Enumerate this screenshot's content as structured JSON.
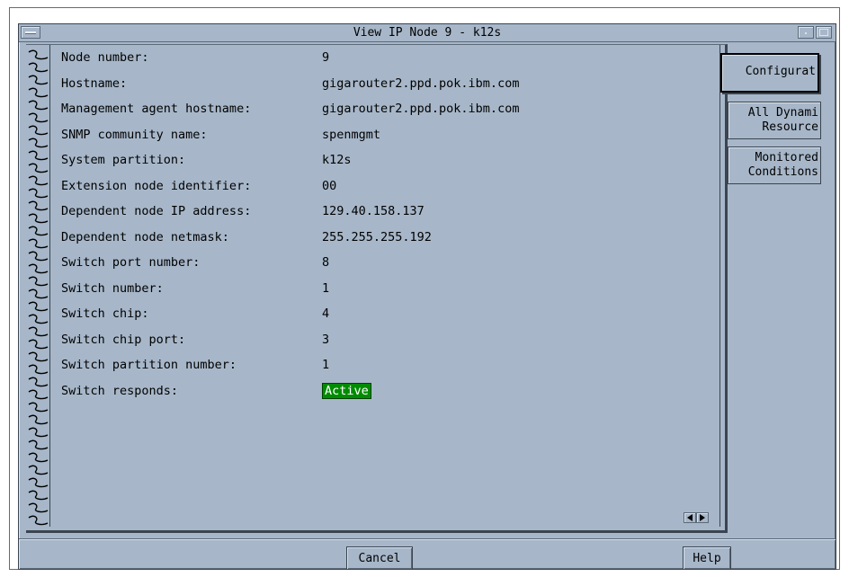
{
  "window": {
    "title": "View IP Node 9 - k12s"
  },
  "fields": [
    {
      "label": "Node number:",
      "value": "9"
    },
    {
      "label": "Hostname:",
      "value": "gigarouter2.ppd.pok.ibm.com"
    },
    {
      "label": "Management agent hostname:",
      "value": "gigarouter2.ppd.pok.ibm.com"
    },
    {
      "label": "SNMP community name:",
      "value": "spenmgmt"
    },
    {
      "label": "System partition:",
      "value": "k12s"
    },
    {
      "label": "Extension node identifier:",
      "value": "00"
    },
    {
      "label": "Dependent node IP address:",
      "value": "129.40.158.137"
    },
    {
      "label": "Dependent node netmask:",
      "value": "255.255.255.192"
    },
    {
      "label": "Switch port number:",
      "value": "8"
    },
    {
      "label": "Switch number:",
      "value": "1"
    },
    {
      "label": "Switch chip:",
      "value": "4"
    },
    {
      "label": "Switch chip port:",
      "value": "3"
    },
    {
      "label": "Switch partition number:",
      "value": "1"
    },
    {
      "label": "Switch responds:",
      "value": "Active"
    }
  ],
  "status_colors": {
    "active_bg": "#008c00",
    "active_fg": "#ffffff"
  },
  "tabs": [
    {
      "line1": "Configurat",
      "line2": ""
    },
    {
      "line1": "All Dynami",
      "line2": "Resource"
    },
    {
      "line1": "Monitored",
      "line2": "Conditions"
    }
  ],
  "buttons": {
    "cancel": "Cancel",
    "help": "Help"
  },
  "icons": {
    "scroll_left": "triangle-left-icon",
    "scroll_right": "triangle-right-icon",
    "window_menu": "window-menu-icon",
    "minimize": "minimize-icon",
    "maximize": "maximize-icon",
    "binding": "spiral-binding-icon"
  }
}
